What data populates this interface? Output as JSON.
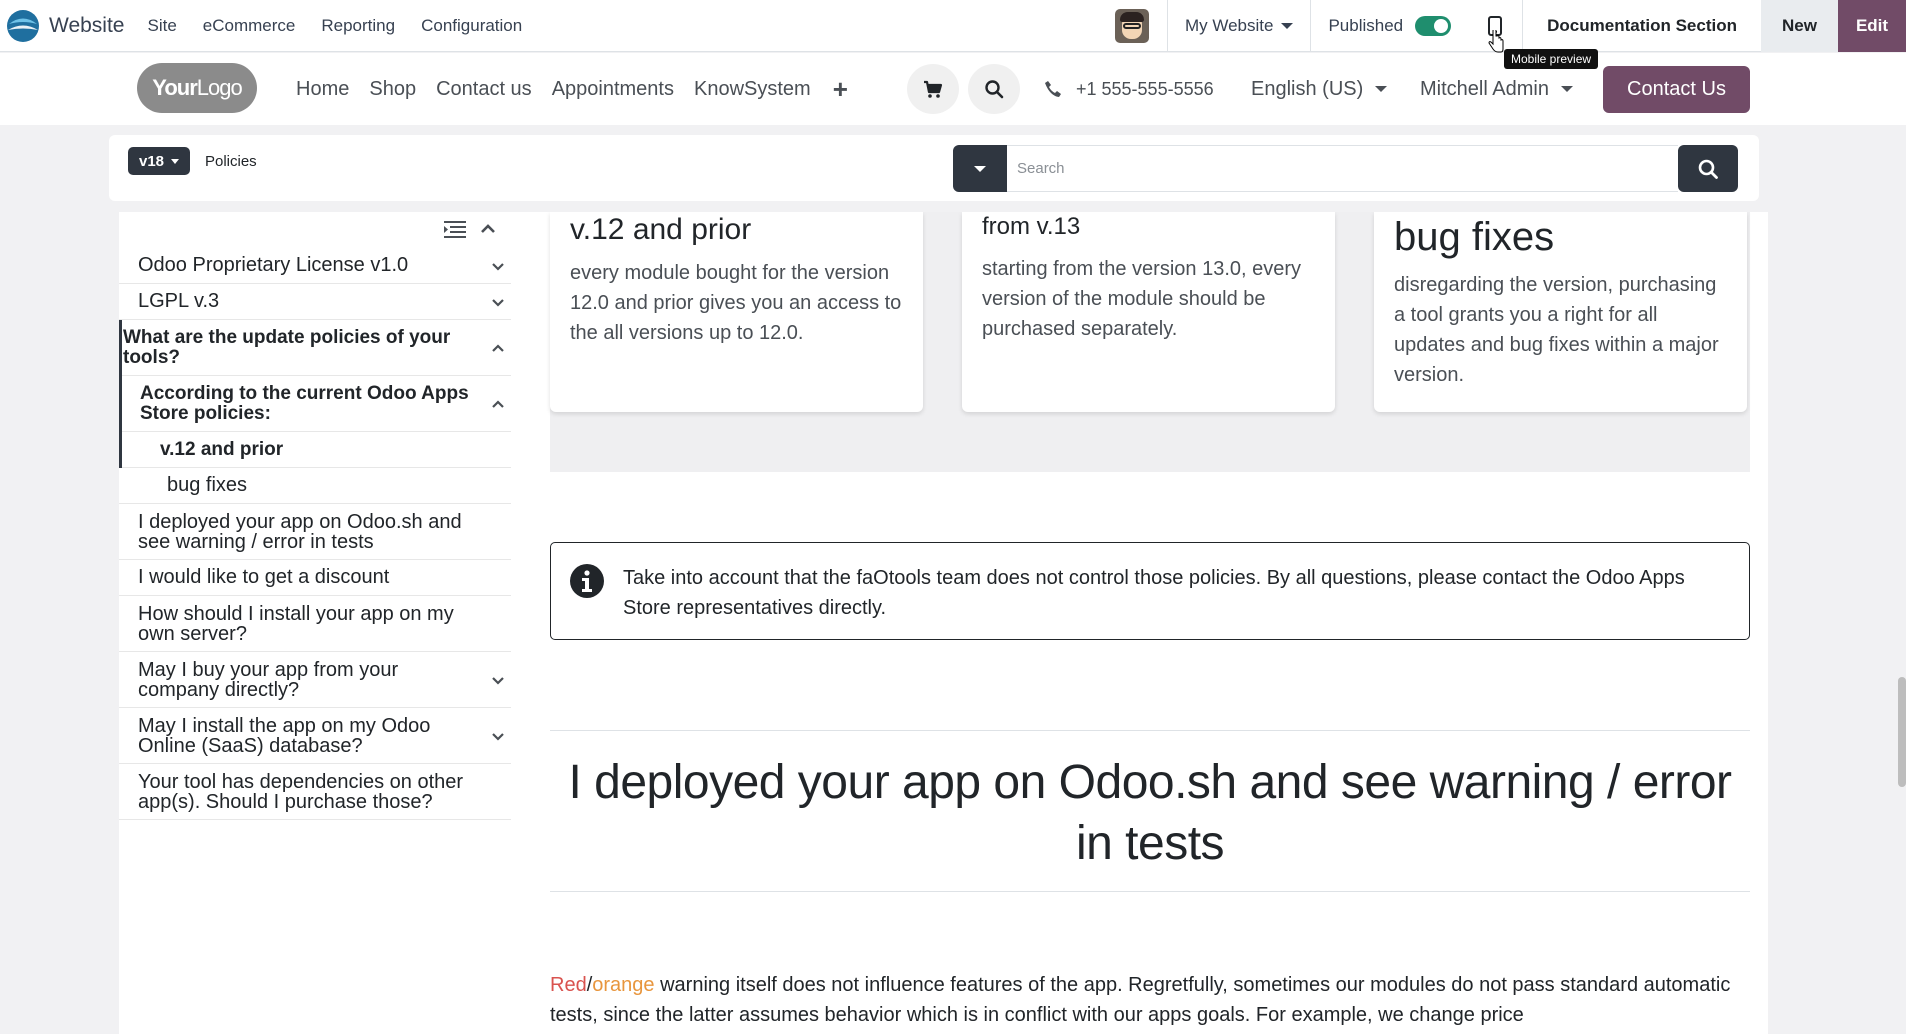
{
  "adminbar": {
    "brand": "Website",
    "menu": [
      "Site",
      "eCommerce",
      "Reporting",
      "Configuration"
    ],
    "my_website": "My Website",
    "published": "Published",
    "doc_section": "Documentation Section",
    "new_label": "New",
    "edit_label": "Edit",
    "tooltip": "Mobile preview"
  },
  "header": {
    "logo_bold": "Your",
    "logo_light": "Logo",
    "nav": [
      "Home",
      "Shop",
      "Contact us",
      "Appointments",
      "KnowSystem"
    ],
    "phone": "+1 555-555-5556",
    "language": "English (US)",
    "user": "Mitchell Admin",
    "contact_button": "Contact Us"
  },
  "toolbar": {
    "version": "v18",
    "breadcrumb": "Policies",
    "search_placeholder": "Search"
  },
  "toc": {
    "items": [
      {
        "label": "Odoo Proprietary License v1.0"
      },
      {
        "label": "LGPL v.3"
      },
      {
        "label": "What are the update policies of your tools?"
      },
      {
        "label": "According to the current Odoo Apps Store policies:"
      },
      {
        "label": "v.12 and prior"
      },
      {
        "label": "bug fixes"
      },
      {
        "label": "I deployed your app on Odoo.sh and see warning / error in tests"
      },
      {
        "label": "I would like to get a discount"
      },
      {
        "label": "How should I install your app on my own server?"
      },
      {
        "label": "May I buy your app from your company directly?"
      },
      {
        "label": "May I install the app on my Odoo Online (SaaS) database?"
      },
      {
        "label": "Your tool has dependencies on other app(s). Should I purchase those?"
      }
    ]
  },
  "content": {
    "cards": [
      {
        "title": "v.12 and prior",
        "text": "every module bought for the version 12.0 and prior gives you an access to the all versions up to 12.0."
      },
      {
        "title": "from v.13",
        "text": "starting from the version 13.0, every version of the module should be purchased separately."
      },
      {
        "title": "bug fixes",
        "text": "disregarding the version, purchasing a tool grants you a right for all updates and bug fixes within a major version."
      }
    ],
    "alert": "Take into account that the faOtools team does not control those policies. By all questions, please contact the Odoo Apps Store representatives directly.",
    "section_title": "I deployed your app on Odoo.sh and see warning / error in tests",
    "body_red": "Red",
    "body_slash": "/",
    "body_orange": "orange",
    "body_rest": " warning itself does not influence features of the app. Regretfully, sometimes our modules do not pass standard automatic tests, since the latter assumes behavior which is in conflict with our apps goals. For example, we change price"
  },
  "colors": {
    "brand_purple": "#714b67",
    "dark_button": "#2f3640",
    "toggle_green": "#1f8e6e",
    "red_text": "#d9534f",
    "orange_text": "#e8963e"
  },
  "icons": [
    "odoo-website-logo-icon",
    "phone-preview-icon",
    "cart-icon",
    "search-icon",
    "phone-icon",
    "toc-list-icon",
    "chevron-up-icon",
    "chevron-down-icon",
    "info-icon"
  ]
}
